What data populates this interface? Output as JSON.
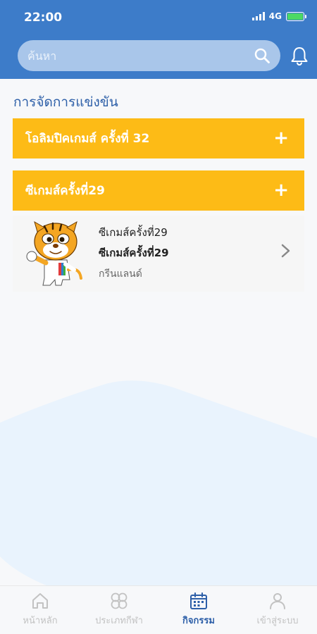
{
  "status": {
    "time": "22:00",
    "network": "4G"
  },
  "search": {
    "placeholder": "ค้นหา"
  },
  "page": {
    "title": "การจัดการแข่งขัน"
  },
  "categories": [
    {
      "label": "โอลิมปิคเกมส์ ครั้งที่ 32",
      "action": "+"
    },
    {
      "label": "ซีเกมส์ครั้งที่29",
      "action": "+"
    }
  ],
  "event": {
    "title": "ซีเกมส์ครั้งที่29",
    "subtitle": "ซีเกมส์ครั้งที่29",
    "location": "กรีนแลนด์"
  },
  "nav": [
    {
      "label": "หน้าหลัก",
      "icon": "home-icon",
      "active": false
    },
    {
      "label": "ประเภทกีฬา",
      "icon": "sports-icon",
      "active": false
    },
    {
      "label": "กิจกรรม",
      "icon": "calendar-icon",
      "active": true
    },
    {
      "label": "เข้าสู่ระบบ",
      "icon": "user-icon",
      "active": false
    }
  ],
  "colors": {
    "header": "#3d7cc9",
    "accent": "#fdbb16",
    "title": "#2d5fa8",
    "nav_active": "#2d5fa8",
    "nav_inactive": "#c2c2c2"
  }
}
